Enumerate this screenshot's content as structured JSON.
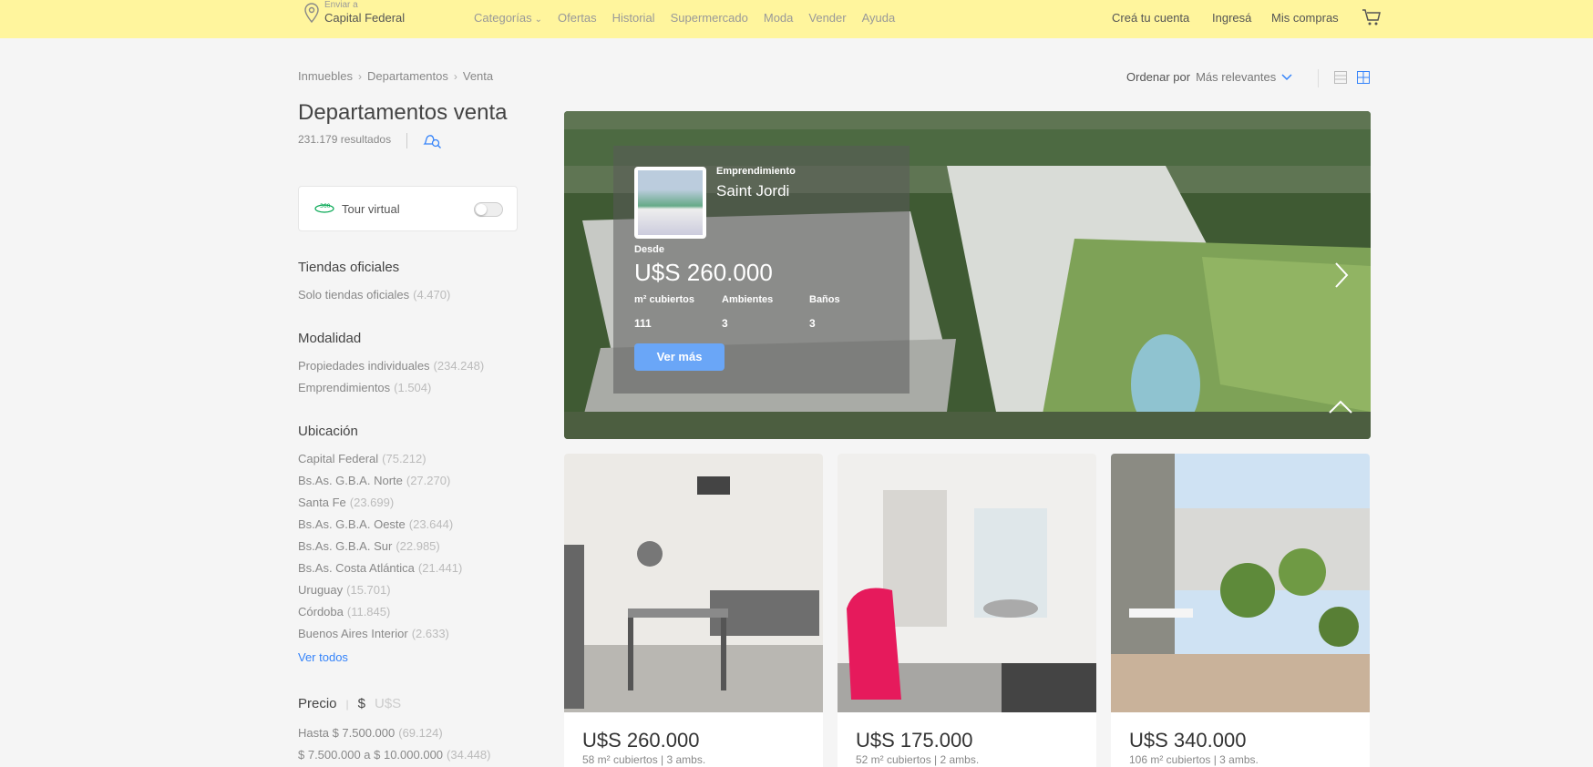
{
  "header": {
    "location_small": "Enviar a",
    "location": "Capital Federal",
    "nav": [
      "Categorías",
      "Ofertas",
      "Historial",
      "Supermercado",
      "Moda",
      "Vender",
      "Ayuda"
    ],
    "create_account": "Creá tu cuenta",
    "login": "Ingresá",
    "my_purchases": "Mis compras",
    "icons": [
      "location-pin-icon",
      "chevron-down-icon",
      "cart-icon"
    ]
  },
  "breadcrumb": [
    "Inmuebles",
    "Departamentos",
    "Venta"
  ],
  "sort": {
    "label": "Ordenar por",
    "value": "Más relevantes"
  },
  "page": {
    "title": "Departamentos venta",
    "results": "231.179 resultados"
  },
  "filters": {
    "tour": "Tour virtual",
    "tiendas": {
      "title": "Tiendas oficiales",
      "items": [
        {
          "label": "Solo tiendas oficiales",
          "count": "(4.470)"
        }
      ]
    },
    "modalidad": {
      "title": "Modalidad",
      "items": [
        {
          "label": "Propiedades individuales",
          "count": "(234.248)"
        },
        {
          "label": "Emprendimientos",
          "count": "(1.504)"
        }
      ]
    },
    "ubicacion": {
      "title": "Ubicación",
      "items": [
        {
          "label": "Capital Federal",
          "count": "(75.212)"
        },
        {
          "label": "Bs.As. G.B.A. Norte",
          "count": "(27.270)"
        },
        {
          "label": "Santa Fe",
          "count": "(23.699)"
        },
        {
          "label": "Bs.As. G.B.A. Oeste",
          "count": "(23.644)"
        },
        {
          "label": "Bs.As. G.B.A. Sur",
          "count": "(22.985)"
        },
        {
          "label": "Bs.As. Costa Atlántica",
          "count": "(21.441)"
        },
        {
          "label": "Uruguay",
          "count": "(15.701)"
        },
        {
          "label": "Córdoba",
          "count": "(11.845)"
        },
        {
          "label": "Buenos Aires Interior",
          "count": "(2.633)"
        }
      ],
      "see_all": "Ver todos"
    },
    "precio": {
      "title": "Precio",
      "currency_ars": "$",
      "currency_usd": "U$S",
      "items": [
        {
          "label": "Hasta $ 7.500.000",
          "count": "(69.124)"
        },
        {
          "label": "$ 7.500.000 a $ 10.000.000",
          "count": "(34.448)"
        }
      ]
    }
  },
  "hero": {
    "tag": "Emprendimiento",
    "name": "Saint Jordi",
    "desde": "Desde",
    "price": "U$S 260.000",
    "attrs": [
      {
        "label": "m² cubiertos",
        "value": "111"
      },
      {
        "label": "Ambientes",
        "value": "3"
      },
      {
        "label": "Baños",
        "value": "3"
      }
    ],
    "cta": "Ver más"
  },
  "listings": [
    {
      "price": "U$S 260.000",
      "sub": "58 m² cubiertos | 3 ambs."
    },
    {
      "price": "U$S 175.000",
      "sub": "52 m² cubiertos | 2 ambs."
    },
    {
      "price": "U$S 340.000",
      "sub": "106 m² cubiertos | 3 ambs."
    }
  ]
}
